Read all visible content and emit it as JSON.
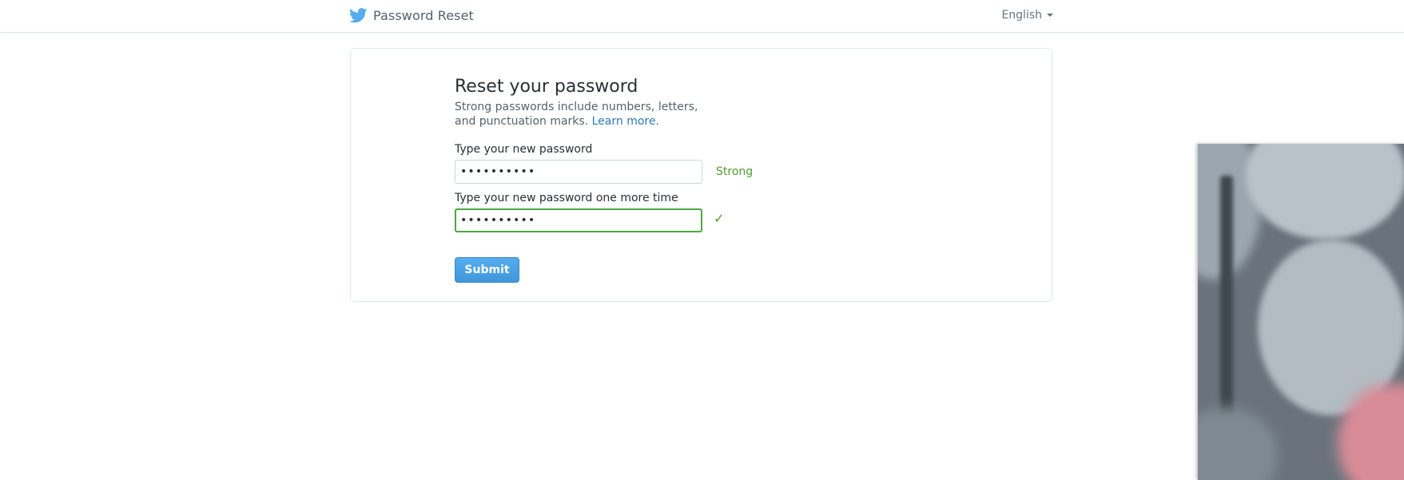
{
  "header": {
    "logo_icon": "twitter-bird-icon",
    "title": "Password Reset",
    "language": "English"
  },
  "form": {
    "heading": "Reset your password",
    "description_prefix": "Strong passwords include numbers, letters, and punctuation marks.",
    "learn_more_label": "Learn more",
    "description_suffix": ".",
    "new_password_label": "Type your new password",
    "new_password_value": "••••••••••",
    "strength_text": "Strong",
    "confirm_password_label": "Type your new password one more time",
    "confirm_password_value": "••••••••••",
    "confirm_status_icon": "checkmark-icon",
    "confirm_status_symbol": "✓",
    "submit_label": "Submit"
  },
  "colors": {
    "brand_blue": "#55acee",
    "link_blue": "#2b7bb9",
    "success_green": "#4e9d2e"
  }
}
